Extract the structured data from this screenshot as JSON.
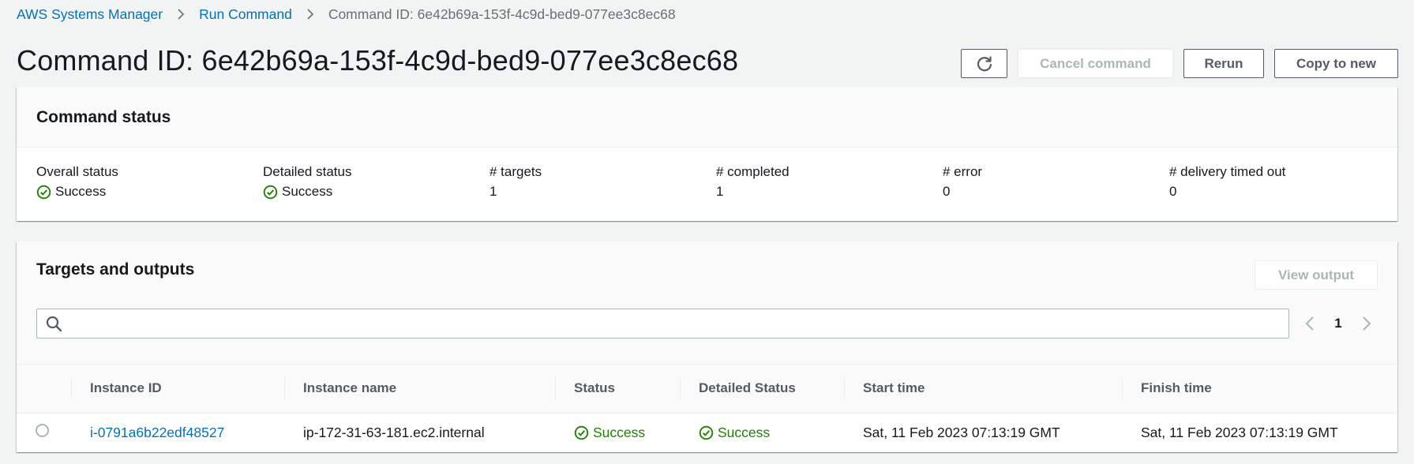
{
  "breadcrumb": {
    "items": [
      "AWS Systems Manager",
      "Run Command"
    ],
    "current": "Command ID: 6e42b69a-153f-4c9d-bed9-077ee3c8ec68"
  },
  "header": {
    "title": "Command ID: 6e42b69a-153f-4c9d-bed9-077ee3c8ec68",
    "refresh_icon": "refresh-icon",
    "cancel_label": "Cancel command",
    "rerun_label": "Rerun",
    "copy_label": "Copy to new"
  },
  "command_status": {
    "title": "Command status",
    "fields": [
      {
        "label": "Overall status",
        "value": "Success",
        "status": "success"
      },
      {
        "label": "Detailed status",
        "value": "Success",
        "status": "success"
      },
      {
        "label": "# targets",
        "value": "1"
      },
      {
        "label": "# completed",
        "value": "1"
      },
      {
        "label": "# error",
        "value": "0"
      },
      {
        "label": "# delivery timed out",
        "value": "0"
      }
    ]
  },
  "targets": {
    "title": "Targets and outputs",
    "view_output_label": "View output",
    "search": {
      "value": "",
      "placeholder": ""
    },
    "pagination": {
      "current_page": "1"
    },
    "columns": [
      "Instance ID",
      "Instance name",
      "Status",
      "Detailed Status",
      "Start time",
      "Finish time"
    ],
    "rows": [
      {
        "instance_id": "i-0791a6b22edf48527",
        "instance_name": "ip-172-31-63-181.ec2.internal",
        "status": "Success",
        "detailed_status": "Success",
        "start_time": "Sat, 11 Feb 2023 07:13:19 GMT",
        "finish_time": "Sat, 11 Feb 2023 07:13:19 GMT"
      }
    ]
  },
  "colors": {
    "link": "#0073bb",
    "success": "#1d8102",
    "disabled": "#aab7b8",
    "text": "#16191f",
    "background": "#f2f3f3"
  }
}
